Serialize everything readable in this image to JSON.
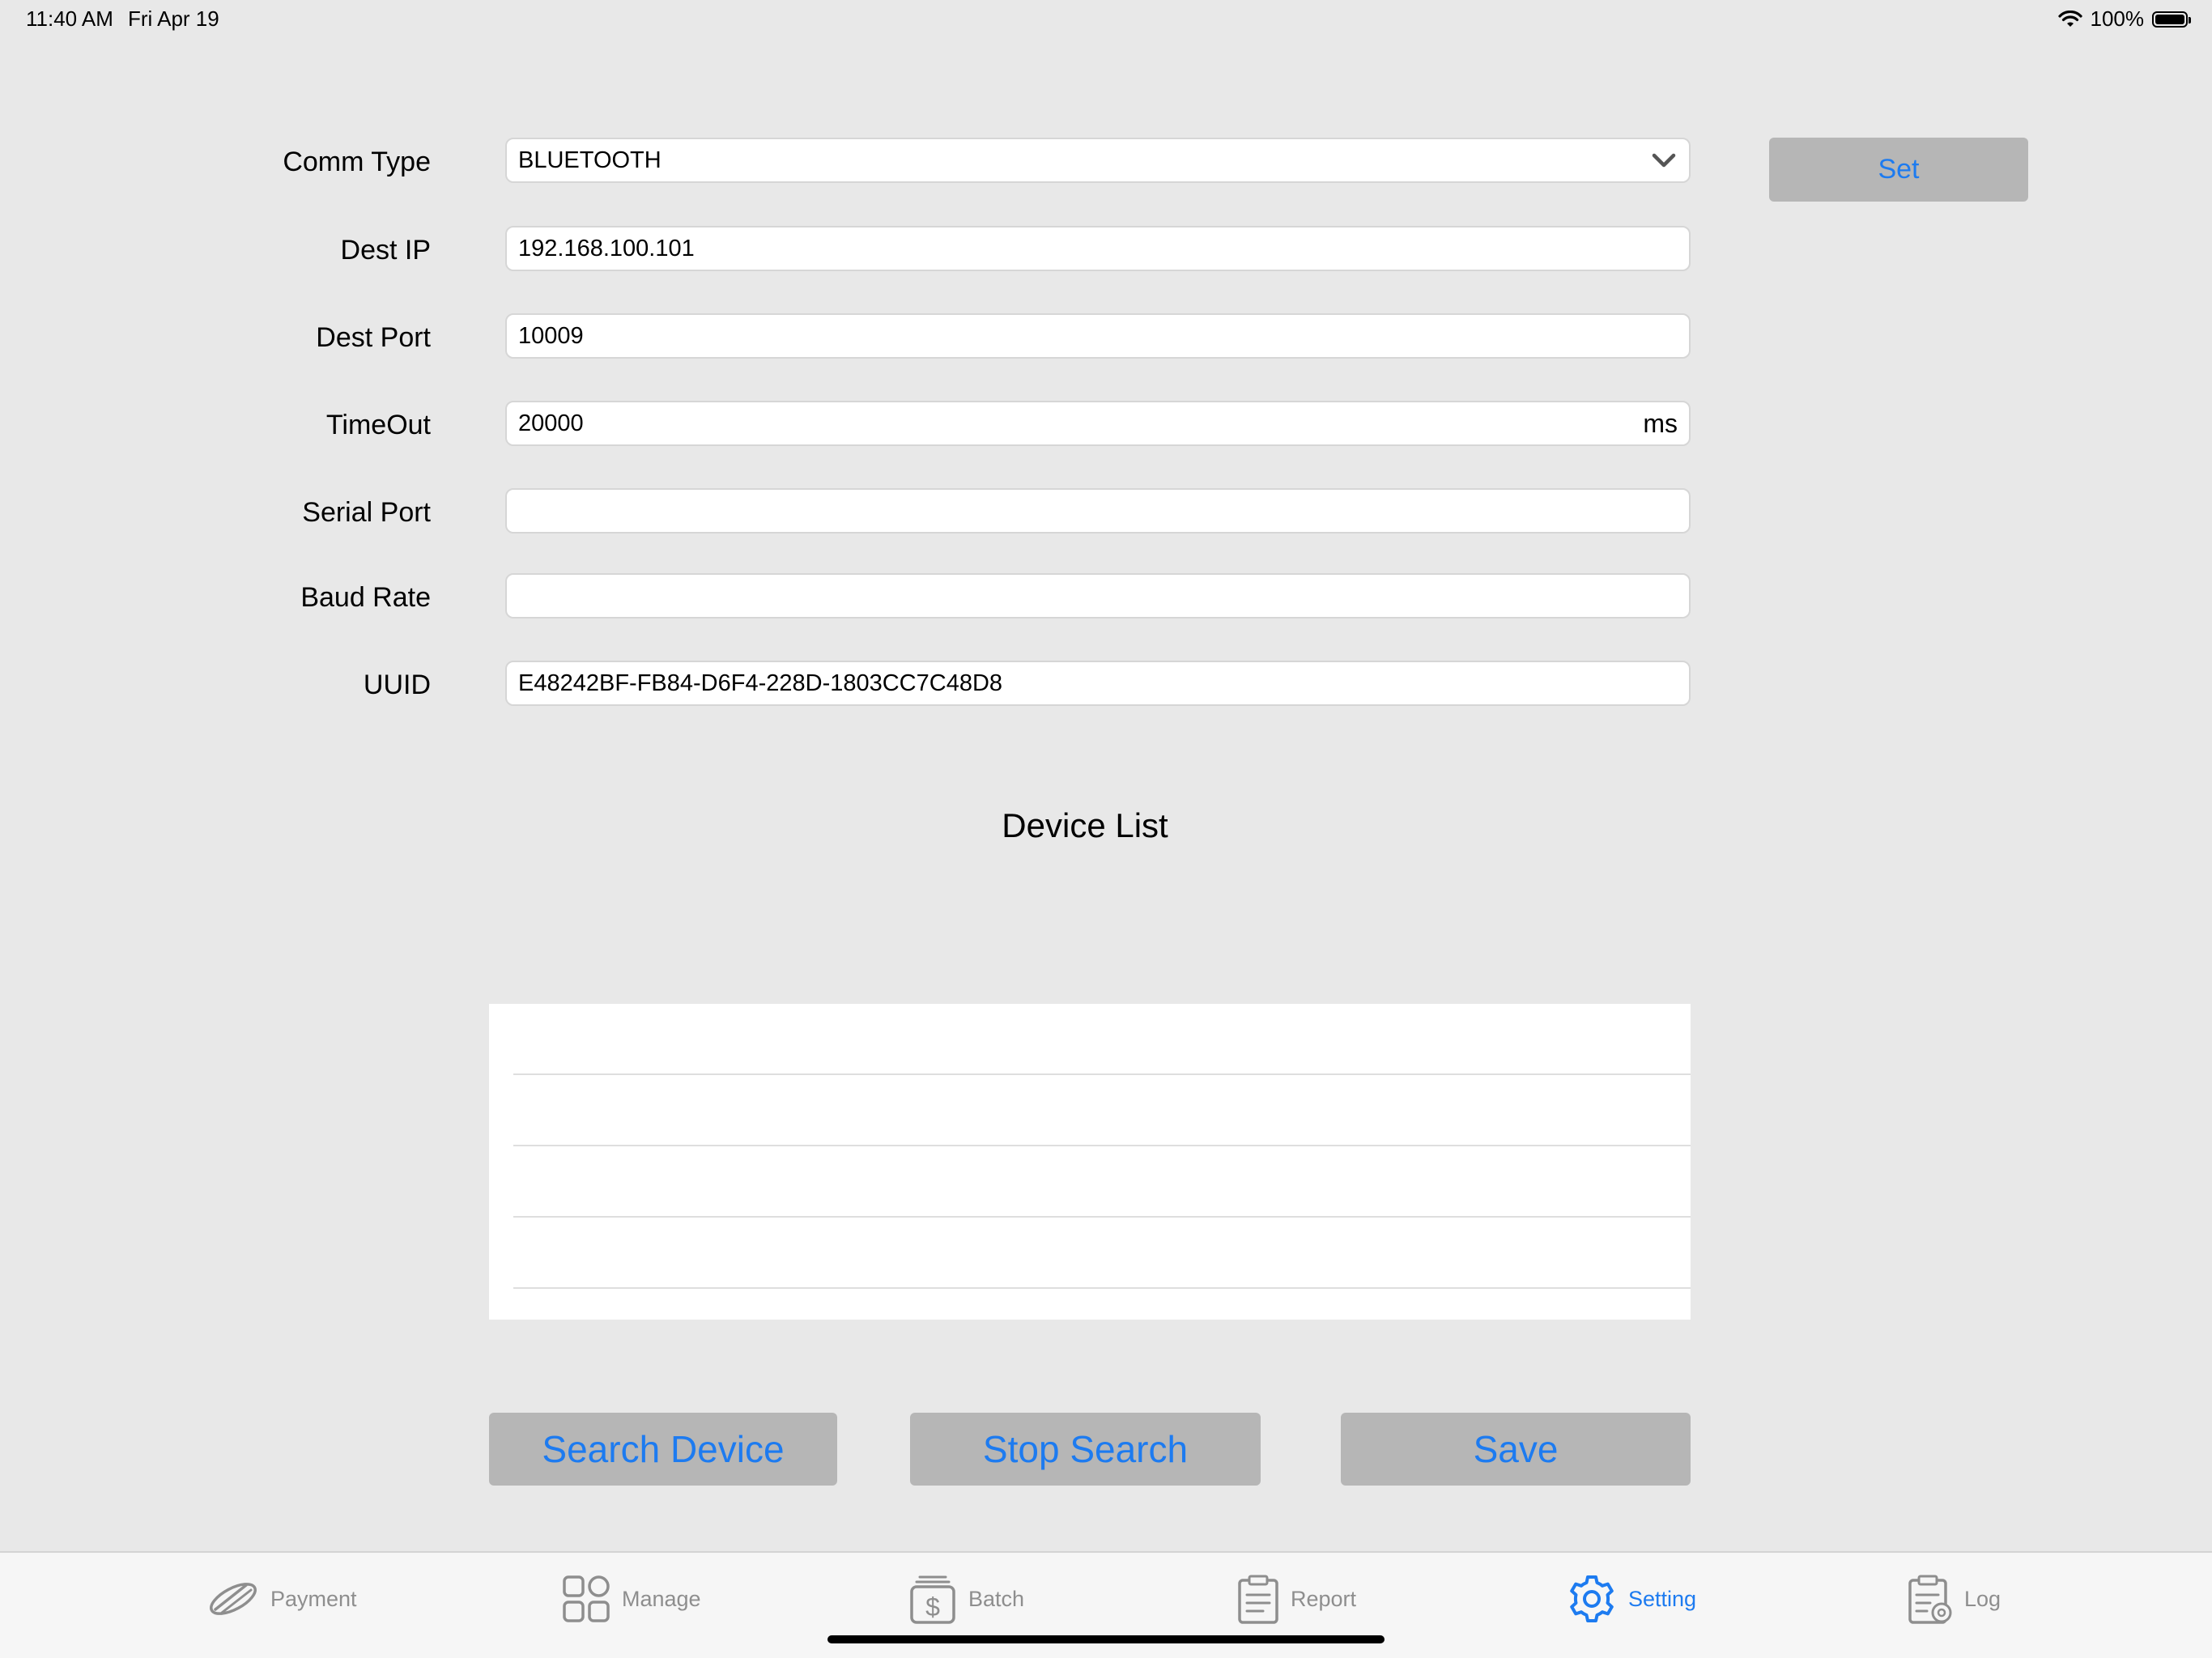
{
  "status_bar": {
    "time": "11:40 AM",
    "date": "Fri Apr 19",
    "battery": "100%",
    "icons": [
      "wifi-icon",
      "battery-icon"
    ]
  },
  "form": {
    "comm_type": {
      "label": "Comm Type",
      "value": "BLUETOOTH",
      "icon": "chevron-down-icon"
    },
    "dest_ip": {
      "label": "Dest IP",
      "value": "192.168.100.101"
    },
    "dest_port": {
      "label": "Dest Port",
      "value": "10009"
    },
    "timeout": {
      "label": "TimeOut",
      "value": "20000",
      "unit": "ms"
    },
    "serial_port": {
      "label": "Serial Port",
      "value": ""
    },
    "baud_rate": {
      "label": "Baud Rate",
      "value": ""
    },
    "uuid": {
      "label": "UUID",
      "value": "E48242BF-FB84-D6F4-228D-1803CC7C48D8"
    }
  },
  "set_button": {
    "label": "Set"
  },
  "device_list": {
    "title": "Device List",
    "rows": [
      "",
      "",
      "",
      ""
    ]
  },
  "actions": {
    "search_device": "Search Device",
    "stop_search": "Stop Search",
    "save": "Save"
  },
  "tab_bar": {
    "tabs": [
      {
        "label": "Payment",
        "icon": "payment-icon",
        "active": false
      },
      {
        "label": "Manage",
        "icon": "grid-icon",
        "active": false
      },
      {
        "label": "Batch",
        "icon": "batch-dollar-icon",
        "active": false
      },
      {
        "label": "Report",
        "icon": "report-clipboard-icon",
        "active": false
      },
      {
        "label": "Setting",
        "icon": "gear-icon",
        "active": true
      },
      {
        "label": "Log",
        "icon": "log-clipboard-icon",
        "active": false
      }
    ]
  },
  "colors": {
    "accent": "#1d7bf0",
    "background": "#e8e8e8",
    "button_gray": "#b6b6b6",
    "tab_inactive": "#8e8e8e"
  }
}
